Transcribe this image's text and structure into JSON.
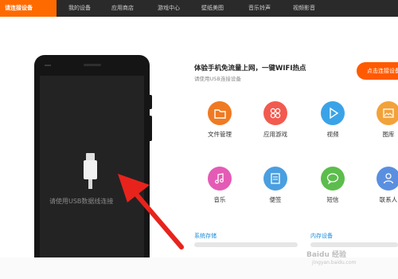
{
  "nav": {
    "tabs": [
      {
        "label": "请连接设备",
        "active": true
      },
      {
        "label": "我的设备"
      },
      {
        "label": "应用商店"
      },
      {
        "label": "游戏中心"
      },
      {
        "label": "壁纸美图"
      },
      {
        "label": "音乐铃声"
      },
      {
        "label": "视频影音"
      }
    ]
  },
  "phone": {
    "usb_hint": "请使用USB数据线连接"
  },
  "promo": {
    "headline": "体验手机免流量上网，一键WIFI热点",
    "subline": "请使用USB连接设备",
    "connect_button": "点击连接设备"
  },
  "functions": [
    {
      "label": "文件管理",
      "icon": "folder-icon",
      "color": "#f07a22"
    },
    {
      "label": "应用游戏",
      "icon": "apps-icon",
      "color": "#f25a4f"
    },
    {
      "label": "视频",
      "icon": "play-icon",
      "color": "#3aa3e8"
    },
    {
      "label": "图库",
      "icon": "gallery-icon",
      "color": "#f2a23a"
    },
    {
      "label": "音乐",
      "icon": "music-icon",
      "color": "#e45bb5"
    },
    {
      "label": "便签",
      "icon": "note-icon",
      "color": "#4a9fe0"
    },
    {
      "label": "短信",
      "icon": "message-icon",
      "color": "#5cbd4c"
    },
    {
      "label": "联系人",
      "icon": "contacts-icon",
      "color": "#5a8fe0"
    }
  ],
  "storage": {
    "system_label": "系统存储",
    "memory_label": "内存设备"
  },
  "watermark": {
    "text": "Baidu 经验",
    "sub": "jingyan.baidu.com"
  },
  "colors": {
    "accent": "#ff6a00",
    "nav_bg": "#2a2a2a",
    "arrow": "#e8231c"
  }
}
